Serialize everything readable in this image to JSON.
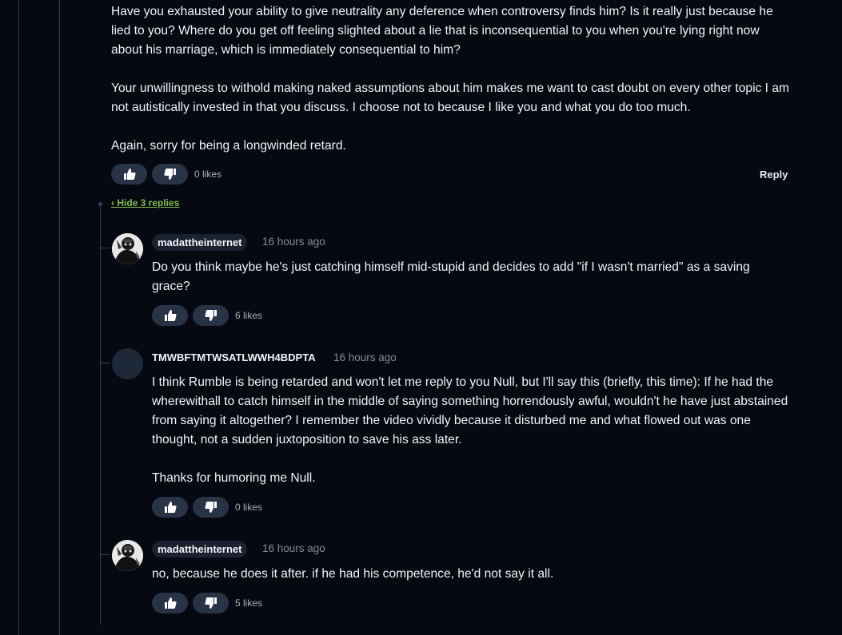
{
  "top_comment": {
    "paragraphs": [
      "Have you exhausted your ability to give neutrality any deference when controversy finds him? Is it really just because he lied to you? Where do you get off feeling slighted about a lie that is inconsequential to you when you're lying right now about his marriage, which is immediately consequential to him?",
      "Your unwillingness to withold making naked assumptions about him makes me want to cast doubt on every other topic I am not autistically invested in that you discuss. I choose not to because I like you and what you do too much.",
      "Again, sorry for being a longwinded retard."
    ],
    "likes": "0 likes",
    "reply_label": "Reply"
  },
  "hide_replies_label": "‹ Hide 3 replies",
  "replies": [
    {
      "username": "madattheinternet",
      "timestamp": "16 hours ago",
      "paragraphs": [
        "Do you think maybe he's just catching himself mid-stupid and decides to add \"if I wasn't married\" as a saving grace?"
      ],
      "likes": "6 likes"
    },
    {
      "username": "TMWBFTMTWSATLWWH4BDPTA",
      "timestamp": "16 hours ago",
      "paragraphs": [
        "I think Rumble is being retarded and won't let me reply to you Null, but I'll say this (briefly, this time): If he had the wherewithall to catch himself in the middle of saying something horrendously awful, wouldn't he have just abstained from saying it altogether? I remember the video vividly because it disturbed me and what flowed out was one thought, not a sudden juxtoposition to save his ass later.",
        "Thanks for humoring me Null."
      ],
      "likes": "0 likes"
    },
    {
      "username": "madattheinternet",
      "timestamp": "16 hours ago",
      "paragraphs": [
        "no, because he does it after. if he had his competence, he'd not say it all."
      ],
      "likes": "5 likes"
    }
  ],
  "icons": {
    "upvote": "thumbs-up-icon",
    "downvote": "thumbs-down-icon"
  },
  "colors": {
    "background": "#060812",
    "vote_button": "#283345",
    "hide_replies_link": "#7fbf4a",
    "timestamp": "#848b99"
  }
}
